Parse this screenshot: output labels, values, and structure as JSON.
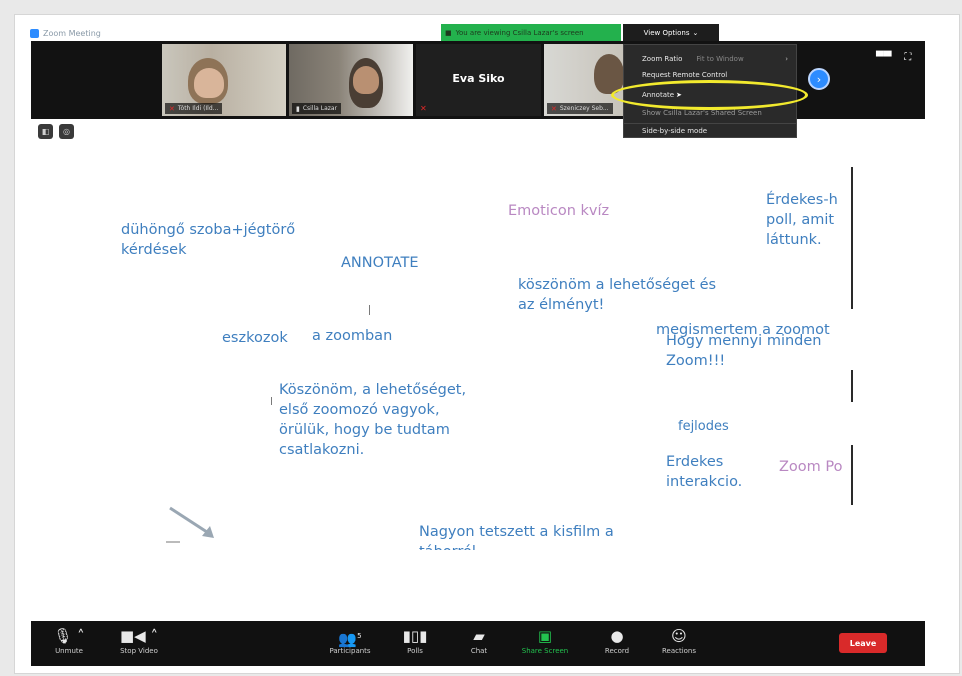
{
  "window": {
    "title": "Zoom Meeting"
  },
  "share_banner": "You are viewing Csilla Lazar's screen",
  "view_options": {
    "label": "View Options",
    "chevron": "chevron-down-icon"
  },
  "participants": [
    {
      "name": "Tóth Ildi (Ild...",
      "muted": true
    },
    {
      "name": "Csilla Lazar",
      "muted": false
    },
    {
      "name": "Eva Siko",
      "muted": true
    },
    {
      "name": "Szeniczey Seb...",
      "muted": true
    }
  ],
  "menu": {
    "items": [
      {
        "label": "Zoom Ratio",
        "sub": "Fit to Window"
      },
      {
        "label": "Request Remote Control"
      },
      {
        "label": "Annotate"
      },
      {
        "label": "Show Csilla Lazar's Shared Screen"
      },
      {
        "label": "Side-by-side mode"
      }
    ]
  },
  "annotations": [
    {
      "text": "dühöngő szoba+jégtörő\nkérdések",
      "color": "blue"
    },
    {
      "text": "ANNOTATE",
      "color": "blue"
    },
    {
      "text": "Emoticon kvíz",
      "color": "pink"
    },
    {
      "text": "Érdekes-h\npoll, amit\nláttunk.",
      "color": "blue"
    },
    {
      "text": "köszönöm a lehetőséget és\naz élményt!",
      "color": "blue"
    },
    {
      "text": "megismertem a zoomot",
      "color": "blue"
    },
    {
      "text": "Hogy mennyi minden\nZoom!!!",
      "color": "blue"
    },
    {
      "text": "eszkozok",
      "color": "blue"
    },
    {
      "text": "a zoomban",
      "color": "blue"
    },
    {
      "text": "Köszönöm, a lehetőséget,\nelső zoomozó vagyok,\nörülük, hogy be tudtam\ncsatlakozni.",
      "color": "blue"
    },
    {
      "text": "fejlodes",
      "color": "blue"
    },
    {
      "text": "Erdekes\ninterakcio.",
      "color": "blue"
    },
    {
      "text": "Zoom Po",
      "color": "pink"
    },
    {
      "text": "Nagyon tetszett a kisfilm a\ntáborról",
      "color": "blue"
    }
  ],
  "toolbar": {
    "unmute": "Unmute",
    "stop_video": "Stop Video",
    "participants": "Participants",
    "participants_count": "5",
    "polls": "Polls",
    "chat": "Chat",
    "share_screen": "Share Screen",
    "record": "Record",
    "reactions": "Reactions",
    "leave": "Leave"
  },
  "colors": {
    "accent": "#2d8cff",
    "banner_green": "#23b14d",
    "leave_red": "#d92a2a",
    "highlight_yellow": "#f2ea2e",
    "annotation_blue": "#3f7fbf",
    "annotation_pink": "#b988c2"
  }
}
